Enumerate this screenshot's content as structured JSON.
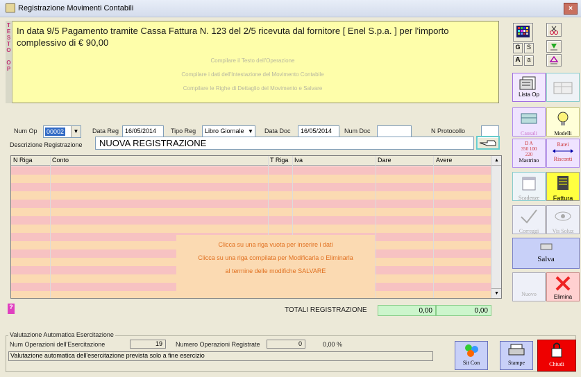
{
  "window": {
    "title": "Registrazione Movimenti Contabili",
    "close_label": "×"
  },
  "testo": {
    "strip": "TESTO OP",
    "text": "In data 9/5 Pagamento tramite Cassa Fattura N. 123 del 2/5 ricevuta dal fornitore [ Enel S.p.a. ] per l'importo complessivo di € 90,00",
    "hint1": "Compilare il Testo dell'Operazione",
    "hint2": "Compilare i dati dell'Intestazione del Movimento Contabile",
    "hint3": "Compilare le Righe di Dettaglio del Movimento e Salvare"
  },
  "tools": {
    "g": "G",
    "s": "S",
    "a_big": "A",
    "a_small": "a",
    "lista_op": "Lista Op"
  },
  "header": {
    "num_op_label": "Num Op",
    "num_op": "00002",
    "data_reg_label": "Data Reg",
    "data_reg": "16/05/2014",
    "tipo_reg_label": "Tipo Reg",
    "tipo_reg": "Libro Giornale",
    "data_doc_label": "Data Doc",
    "data_doc": "16/05/2014",
    "num_doc_label": "Num Doc",
    "num_doc": "",
    "protocollo_label": "N Protocollo",
    "protocollo": ""
  },
  "descrizione": {
    "label": "Descrizione Registrazione",
    "value": "NUOVA REGISTRAZIONE"
  },
  "grid": {
    "columns": [
      "N Riga",
      "Conto",
      "T Riga",
      "Iva",
      "Dare",
      "Avere"
    ],
    "msg1": "Clicca su una riga vuota per inserire i dati",
    "msg2": "Clicca su una riga compilata per Modificarla o Eliminarla",
    "msg3": "al termine delle modifiche SALVARE"
  },
  "totals": {
    "label": "TOTALI REGISTRAZIONE",
    "dare": "0,00",
    "avere": "0,00"
  },
  "help": "?",
  "side": {
    "causali": "Causali",
    "modelli": "Modelli",
    "mastrino_top": "D   A",
    "mastrino_nums": "350 100 220",
    "mastrino": "Mastrino",
    "ratei": "Ratei",
    "risconti": "Risconti",
    "scadenze": "Scadenze",
    "fattura": "Fattura",
    "correggi": "Correggi",
    "vis_soluz": "Vis Soluz",
    "salva": "Salva",
    "nuovo": "Nuovo",
    "elimina": "Elimina"
  },
  "valutazione": {
    "legend": "Valutazione Automatica Esercitazione",
    "num_ops_label": "Num Operazioni dell'Esercitazione",
    "num_ops": "19",
    "registered_label": "Numero Operazioni Registrate",
    "registered": "0",
    "percent": "0,00 %",
    "note": "Valutazione automatica dell'esercitazione prevista solo a fine esercizio"
  },
  "footer": {
    "sit_con": "Sit Con",
    "stampe": "Stampe",
    "chiudi": "Chiudi"
  },
  "colors": {
    "row_pink": "#f7c2c2",
    "row_peach": "#fbdab2",
    "panel_yellow": "#fefeaa",
    "total_green": "#ccf5cc"
  }
}
